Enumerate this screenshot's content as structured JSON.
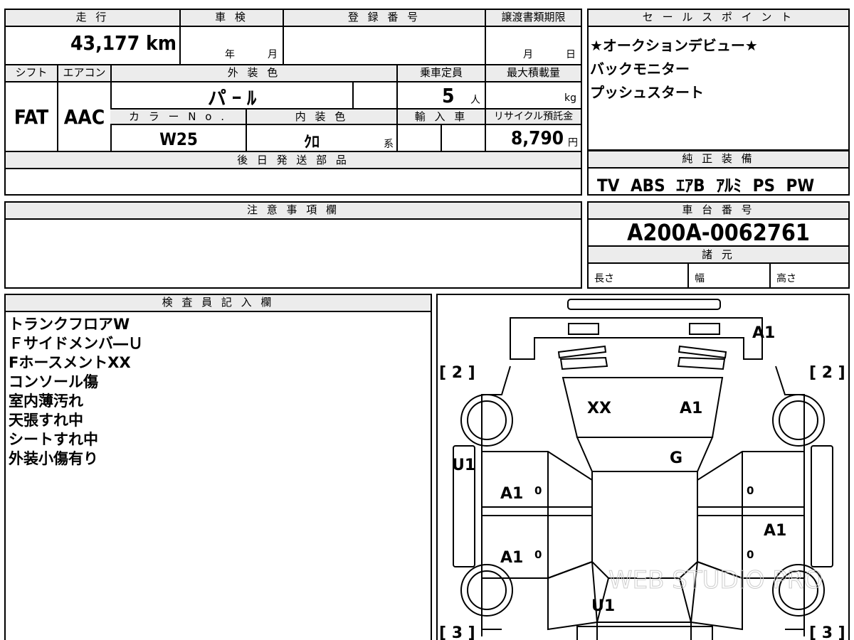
{
  "top_info": {
    "headers": {
      "mileage": "走 行",
      "shaken": "車 検",
      "registration": "登 録 番 号",
      "transfer_deadline": "譲渡書類期限",
      "shift": "シフト",
      "aircon": "エアコン",
      "exterior_color": "外 装 色",
      "capacity": "乗車定員",
      "max_load": "最大積載量",
      "color_no": "カ ラ ー N o .",
      "interior_color": "内 装 色",
      "import": "輸 入 車",
      "recycle": "リサイクル預託金",
      "later_parts": "後 日 発 送 部 品"
    },
    "mileage_value": "43,177",
    "mileage_unit": "km",
    "shaken_year": "年",
    "shaken_month": "月",
    "deadline_month": "月",
    "deadline_day": "日",
    "shift_value": "FAT",
    "aircon_value": "AAC",
    "exterior_color_value": "パ ｰ ﾙ",
    "capacity_value": "5",
    "capacity_unit": "人",
    "max_load_unit": "kg",
    "color_no_value": "W25",
    "interior_color_value": "ｸﾛ",
    "interior_suffix": "系",
    "recycle_value": "8,790",
    "recycle_unit": "円"
  },
  "sales_points": {
    "header": "セ ー ル ス ポ イ ン ト",
    "lines": [
      "★オークションデビュー★",
      "バックモニター",
      "プッシュスタート"
    ]
  },
  "equipment": {
    "header": "純 正 装 備",
    "value": "TV ABS ｴｱB ｱﾙﾐ PS PW"
  },
  "notes": {
    "header": "注 意 事 項 欄"
  },
  "chassis": {
    "header": "車 台 番 号",
    "value": "A200A-0062761",
    "specs_header": "諸 元",
    "length": "長さ",
    "width": "幅",
    "height": "高さ"
  },
  "inspector": {
    "header": "検 査 員 記 入 欄",
    "lines": [
      "トランクフロアW",
      "Ｆサイドメンバ―Ｕ",
      "FホースメントXX",
      "コンソール傷",
      "室内薄汚れ",
      "天張すれ中",
      "シートすれ中",
      "外装小傷有り"
    ]
  },
  "diagram": {
    "watermark": "WEB STUDIO PRO",
    "marks": {
      "front_bumper": "A1",
      "hood_left": "XX",
      "hood_right": "A1",
      "windshield": "G",
      "left_rocker": "U1",
      "left_front_door": "A1",
      "left_rear_door": "A1",
      "right_rear_door": "A1",
      "rear": "U1",
      "front_left_bracket": "[ 2 ]",
      "front_right_bracket": "[ 2 ]",
      "rear_left_bracket": "[ 3 ]",
      "rear_right_bracket": "[ 3 ]",
      "door_zero": "0"
    }
  }
}
